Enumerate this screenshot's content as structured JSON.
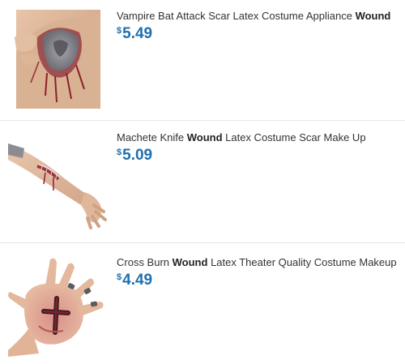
{
  "products": [
    {
      "title_prefix": "Vampire Bat Attack Scar Latex Costume Appliance ",
      "title_bold": "Wound",
      "title_suffix": "",
      "currency": "$",
      "price": "5.49",
      "image_icon": "shoulder-wound-image"
    },
    {
      "title_prefix": "Machete Knife ",
      "title_bold": "Wound",
      "title_suffix": " Latex Costume Scar Make Up",
      "currency": "$",
      "price": "5.09",
      "image_icon": "arm-wound-image"
    },
    {
      "title_prefix": "Cross Burn ",
      "title_bold": "Wound",
      "title_suffix": " Latex Theater Quality Costume Makeup",
      "currency": "$",
      "price": "4.49",
      "image_icon": "hand-wound-image"
    }
  ],
  "colors": {
    "price": "#1f6fae",
    "title": "#333333",
    "divider": "#e6e6e6"
  }
}
